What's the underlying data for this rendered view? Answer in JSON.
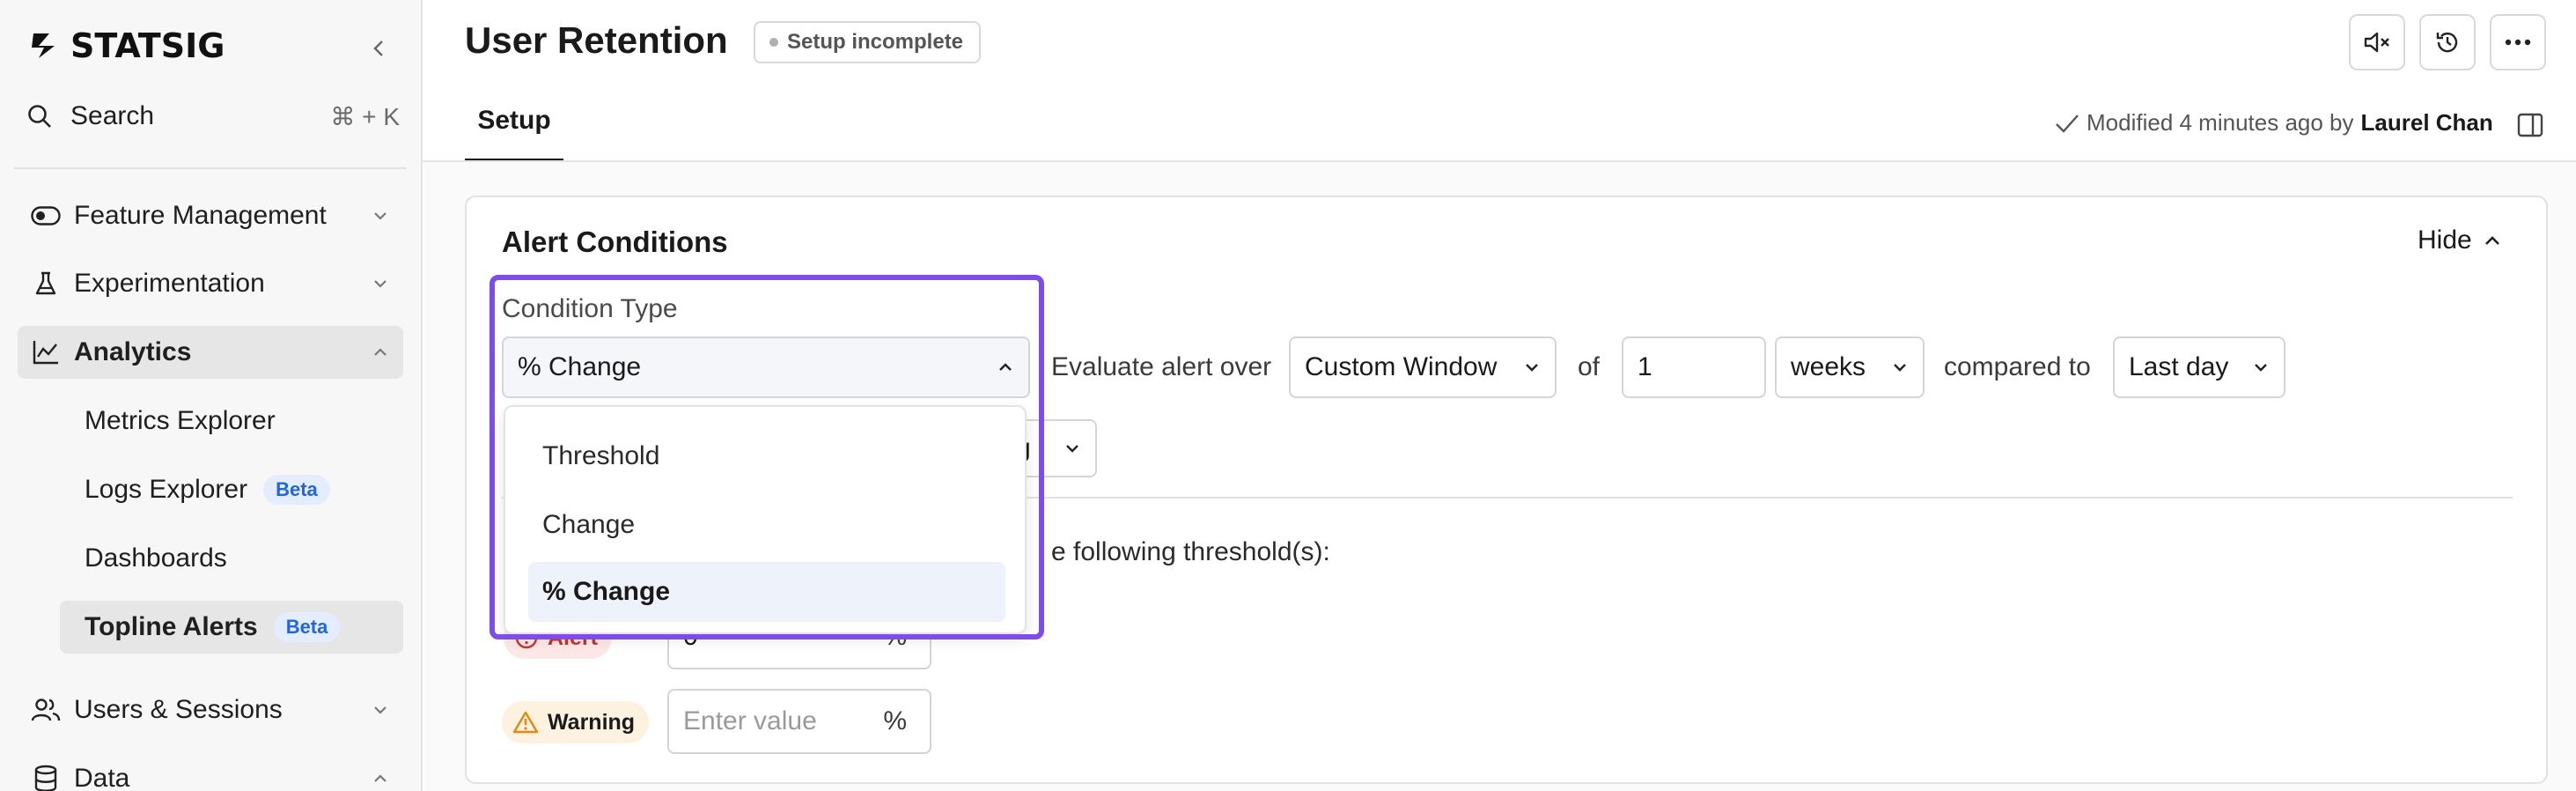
{
  "brand": {
    "name": "STATSIG"
  },
  "sidebar": {
    "search": {
      "label": "Search",
      "shortcut": "⌘ + K"
    },
    "items": [
      {
        "label": "Feature Management",
        "icon": "toggle-icon"
      },
      {
        "label": "Experimentation",
        "icon": "flask-icon"
      },
      {
        "label": "Analytics",
        "icon": "analytics-icon"
      },
      {
        "label": "Users & Sessions",
        "icon": "users-icon"
      },
      {
        "label": "Data",
        "icon": "database-icon"
      }
    ],
    "analytics_sub": [
      {
        "label": "Metrics Explorer"
      },
      {
        "label": "Logs Explorer",
        "badge": "Beta"
      },
      {
        "label": "Dashboards"
      },
      {
        "label": "Topline Alerts",
        "badge": "Beta"
      }
    ]
  },
  "header": {
    "title": "User Retention",
    "status": "Setup incomplete",
    "tab": "Setup",
    "modified_prefix": "Modified 4 minutes ago by",
    "modified_by": "Laurel Chan"
  },
  "card": {
    "title": "Alert Conditions",
    "hide_label": "Hide",
    "condition_type_label": "Condition Type",
    "condition_type_value": "% Change",
    "evaluate_label": "Evaluate alert over",
    "window_value": "Custom Window",
    "of_label": "of",
    "window_count": "1",
    "window_unit": "weeks",
    "compared_label": "compared to",
    "compared_value": "Last day",
    "second_row_partial": "g",
    "threshold_text": "e following threshold(s):",
    "alert_label": "Alert",
    "alert_value": "0",
    "warning_label": "Warning",
    "warning_placeholder": "Enter value",
    "unit": "%"
  },
  "dropdown": {
    "options": [
      "Threshold",
      "Change",
      "% Change"
    ],
    "selected": "% Change"
  },
  "colors": {
    "highlight": "#7e4ce6",
    "beta_text": "#2466d6",
    "alert": "#c23434",
    "warning": "#e08a12"
  }
}
